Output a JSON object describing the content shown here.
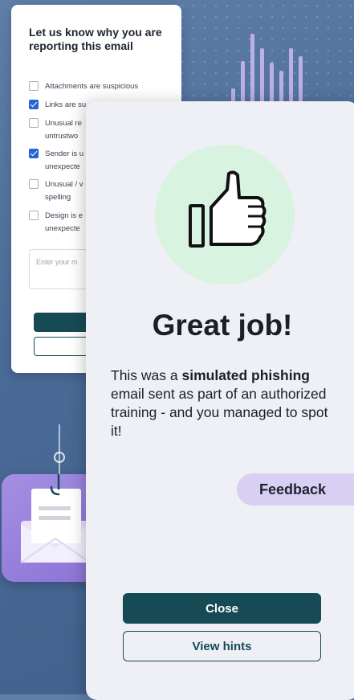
{
  "report_form": {
    "title": "Let us know why you are reporting this email",
    "options": [
      {
        "label": "Attachments are suspicious",
        "checked": false
      },
      {
        "label": "Links are su",
        "checked": true
      },
      {
        "label": "Unusual re\nuntrustwo",
        "checked": false
      },
      {
        "label": "Sender is u\nunexpecte",
        "checked": true
      },
      {
        "label": "Unusual / v\nspelling",
        "checked": false
      },
      {
        "label": "Design is e\nunexpecte",
        "checked": false
      }
    ],
    "comment_placeholder": "Enter your m"
  },
  "result_dialog": {
    "icon": "thumbs-up-icon",
    "headline": "Great job!",
    "message_prefix": "This was a ",
    "message_bold": "simulated phishing",
    "message_suffix": " email sent as part of an authorized training - and you managed to  spot it!",
    "feedback_label": "Feedback",
    "close_label": "Close",
    "hints_label": "View hints"
  },
  "colors": {
    "primary": "#164b56",
    "success_circle": "#d8f3df",
    "accent_lavender": "#d9cff2",
    "background": "#4a6b97"
  }
}
